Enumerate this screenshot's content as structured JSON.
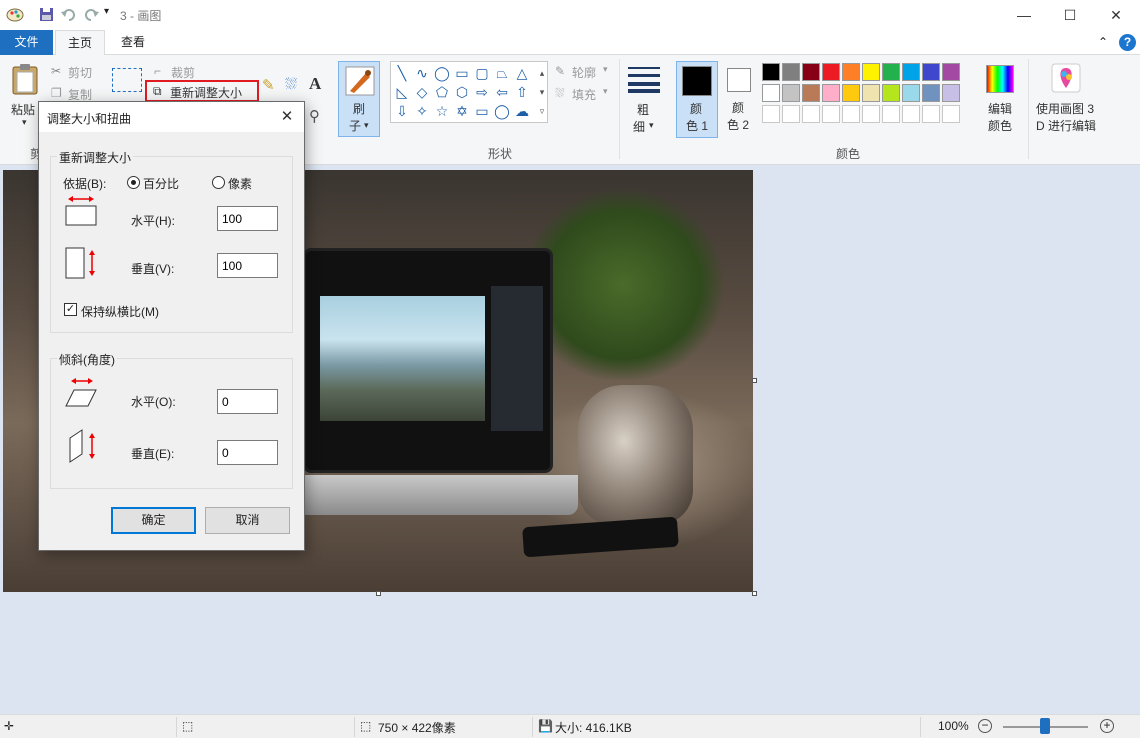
{
  "window": {
    "title": "3 - 画图",
    "quick_access": [
      "save-icon",
      "undo-icon",
      "redo-icon"
    ],
    "controls": {
      "minimize": "—",
      "maximize": "☐",
      "close": "✕"
    }
  },
  "tabs": {
    "file": "文件",
    "home": "主页",
    "view": "查看"
  },
  "ribbon": {
    "clipboard": {
      "paste": "粘贴",
      "cut": "剪切",
      "copy": "复制",
      "group_partial": "剪"
    },
    "image": {
      "crop": "裁剪",
      "resize": "重新调整大小"
    },
    "brush": {
      "label_line1": "刷",
      "label_line2": "子"
    },
    "shapes": {
      "outline": "轮廓",
      "fill": "填充",
      "group": "形状"
    },
    "size": {
      "label_line1": "粗",
      "label_line2": "细"
    },
    "color1": {
      "line1": "颜",
      "line2": "色 1",
      "value": "#000000"
    },
    "color2": {
      "line1": "颜",
      "line2": "色 2",
      "value": "#ffffff"
    },
    "palette_row1": [
      "#000000",
      "#7f7f7f",
      "#880015",
      "#ed1c24",
      "#ff7f27",
      "#fff200",
      "#22b14c",
      "#00a2e8",
      "#3f48cc",
      "#a349a4"
    ],
    "palette_row2": [
      "#ffffff",
      "#c3c3c3",
      "#b97a57",
      "#ffaec9",
      "#ffc90e",
      "#efe4b0",
      "#b5e61d",
      "#99d9ea",
      "#7092be",
      "#c8bfe7"
    ],
    "edit_colors": {
      "line1": "编辑",
      "line2": "颜色"
    },
    "colors_group": "颜色",
    "paint3d": {
      "line1": "使用画图 3",
      "line2": "D 进行编辑"
    }
  },
  "dialog": {
    "title": "调整大小和扭曲",
    "resize_section": "重新调整大小",
    "by_label": "依据(B):",
    "option_percent": "百分比",
    "option_pixels": "像素",
    "resize_horizontal_label": "水平(H):",
    "resize_horizontal_value": "100",
    "resize_vertical_label": "垂直(V):",
    "resize_vertical_value": "100",
    "keep_aspect": "保持纵横比(M)",
    "skew_section": "倾斜(角度)",
    "skew_horizontal_label": "水平(O):",
    "skew_horizontal_value": "0",
    "skew_vertical_label": "垂直(E):",
    "skew_vertical_value": "0",
    "ok": "确定",
    "cancel": "取消"
  },
  "status": {
    "dimensions": "750 × 422像素",
    "file_size": "大小: 416.1KB",
    "zoom": "100%"
  }
}
